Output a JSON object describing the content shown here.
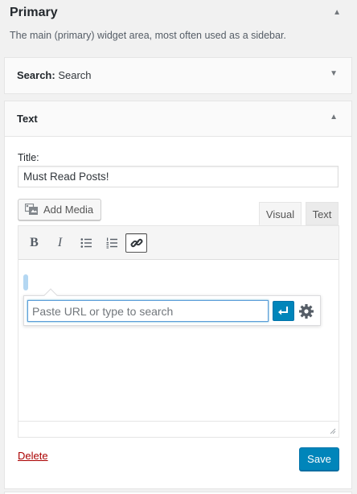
{
  "sidebar_area": {
    "title": "Primary",
    "description": "The main (primary) widget area, most often used as a sidebar.",
    "collapse_icon": "triangle-up-icon"
  },
  "search_widget": {
    "title": "Search",
    "in_widget_title": "Search",
    "expand_icon": "triangle-down-icon"
  },
  "text_widget": {
    "title": "Text",
    "collapse_icon": "triangle-up-icon",
    "title_field_label": "Title:",
    "title_value": "Must Read Posts!",
    "add_media_label": "Add Media",
    "tabs": {
      "visual": "Visual",
      "text": "Text",
      "active": "visual"
    },
    "toolbar": {
      "bold": "B",
      "italic": "I",
      "buttons": [
        "bold",
        "italic",
        "bulleted-list",
        "numbered-list",
        "link"
      ],
      "active": "link"
    },
    "link_popup": {
      "placeholder": "Paste URL or type to search",
      "value": ""
    },
    "delete_label": "Delete",
    "save_label": "Save"
  },
  "colors": {
    "primary": "#0085ba",
    "delete": "#a00000",
    "focus_border": "#5b9dd9"
  }
}
